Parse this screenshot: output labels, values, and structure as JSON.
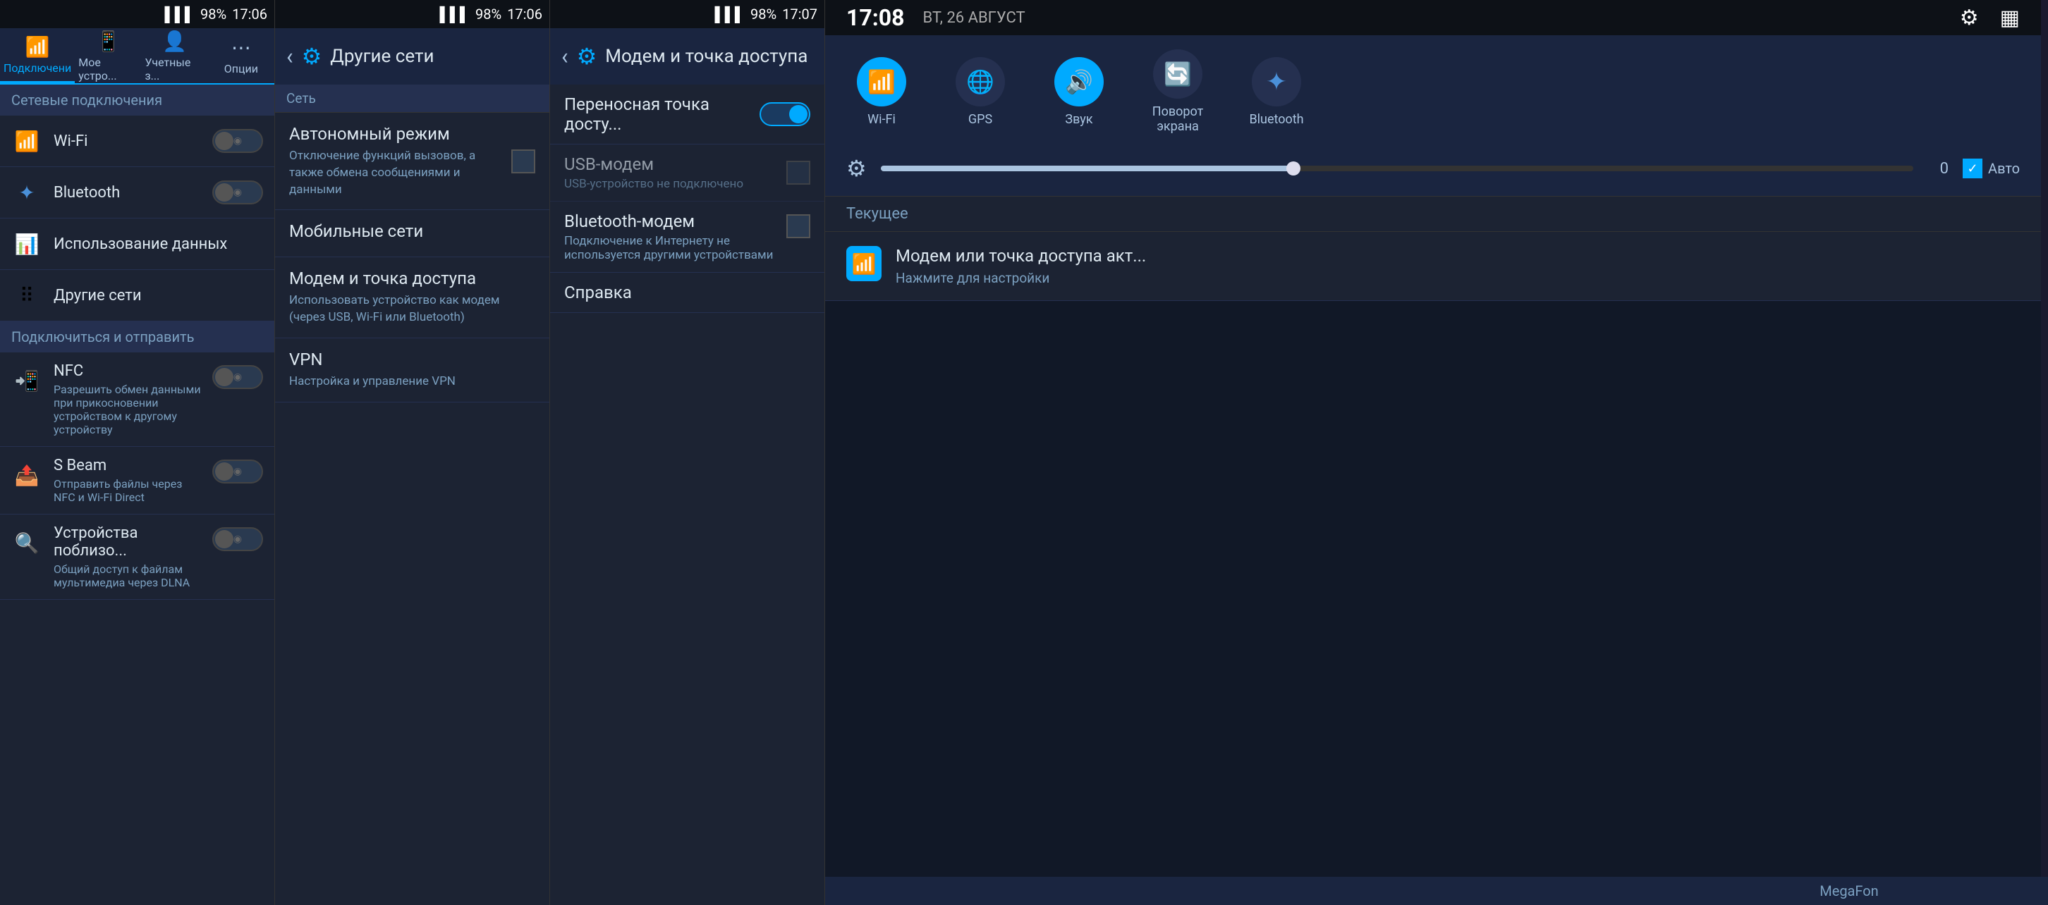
{
  "panel1": {
    "status": {
      "signal": "▌▌▌▌",
      "battery": "98%",
      "time": "17:06"
    },
    "tabs": [
      {
        "id": "connections",
        "label": "Подключени",
        "icon": "📶",
        "active": true
      },
      {
        "id": "my-device",
        "label": "Мое устро...",
        "icon": "📱",
        "active": false
      },
      {
        "id": "accounts",
        "label": "Учетные з...",
        "icon": "👤",
        "active": false
      },
      {
        "id": "options",
        "label": "Опции",
        "icon": "⋯",
        "active": false
      }
    ],
    "section1": {
      "label": "Сетевые подключения"
    },
    "items": [
      {
        "id": "wifi",
        "icon": "📶",
        "label": "Wi-Fi",
        "has_toggle": true
      },
      {
        "id": "bluetooth",
        "icon": "🔷",
        "label": "Bluetooth",
        "has_toggle": true
      }
    ],
    "section2": {
      "label": "Использование данных",
      "icon": "📊"
    },
    "section3": {
      "label": "Другие сети",
      "icon": "⠿"
    },
    "section_connect": {
      "label": "Подключиться и отправить"
    },
    "connect_items": [
      {
        "id": "nfc",
        "icon": "📲",
        "label": "NFC",
        "sub": "Разрешить обмен данными при прикосновении устройством к другому устройству",
        "has_toggle": true
      },
      {
        "id": "sbeam",
        "icon": "📤",
        "label": "S Beam",
        "sub": "Отправить файлы через NFC и Wi-Fi Direct",
        "has_toggle": true
      },
      {
        "id": "nearby",
        "icon": "🔍",
        "label": "Устройства поблизо...",
        "sub": "Общий доступ к файлам мультимедиа через DLNA",
        "has_toggle": true
      }
    ]
  },
  "panel2": {
    "status": {
      "signal": "▌▌▌▌",
      "battery": "98%",
      "time": "17:06"
    },
    "title": "Другие сети",
    "section_label": "Сеть",
    "items": [
      {
        "id": "auto-mode",
        "label": "Автономный режим",
        "sub": "Отключение функций вызовов, а также обмена сообщениями и данными",
        "has_checkbox": true
      },
      {
        "id": "mobile-nets",
        "label": "Мобильные сети",
        "sub": ""
      },
      {
        "id": "tethering",
        "label": "Модем и точка доступа",
        "sub": "Использовать устройство как модем (через USB, Wi-Fi или Bluetooth)"
      },
      {
        "id": "vpn",
        "label": "VPN",
        "sub": "Настройка и управление VPN"
      }
    ]
  },
  "panel3": {
    "status": {
      "signal": "▌▌▌▌",
      "battery": "98%",
      "time": "17:07"
    },
    "title": "Модем и точка доступа",
    "items": [
      {
        "id": "portable-hotspot",
        "label": "Переносная точка досту...",
        "sub": "",
        "has_toggle": true,
        "toggle_on": true
      },
      {
        "id": "usb-modem",
        "label": "USB-модем",
        "sub": "USB-устройство не подключено",
        "has_checkbox": true,
        "disabled": true
      },
      {
        "id": "bt-modem",
        "label": "Bluetooth-модем",
        "sub": "Подключение к Интернету не используется другими устройствами",
        "has_checkbox": true
      },
      {
        "id": "help",
        "label": "Справка",
        "sub": ""
      }
    ]
  },
  "panel4": {
    "time": "17:08",
    "date": "ВТ, 26 АВГУСТ",
    "quick_toggles": [
      {
        "id": "wifi",
        "icon": "📶",
        "label": "Wi-Fi",
        "active": true
      },
      {
        "id": "gps",
        "icon": "🌐",
        "label": "GPS",
        "active": false
      },
      {
        "id": "sound",
        "icon": "🔊",
        "label": "Звук",
        "active": true
      },
      {
        "id": "rotate",
        "icon": "🔄",
        "label": "Поворот\nэкрана",
        "active": false
      },
      {
        "id": "bluetooth",
        "icon": "🔷",
        "label": "Bluetooth",
        "active": false
      }
    ],
    "brightness": {
      "value": "0",
      "auto_label": "Авто",
      "fill_percent": 40
    },
    "section_current": "Текущее",
    "notifications": [
      {
        "id": "hotspot",
        "icon": "📶",
        "title": "Модем или точка доступа акт...",
        "sub": "Нажмите для настройки"
      }
    ],
    "footer": "MegaFon"
  }
}
